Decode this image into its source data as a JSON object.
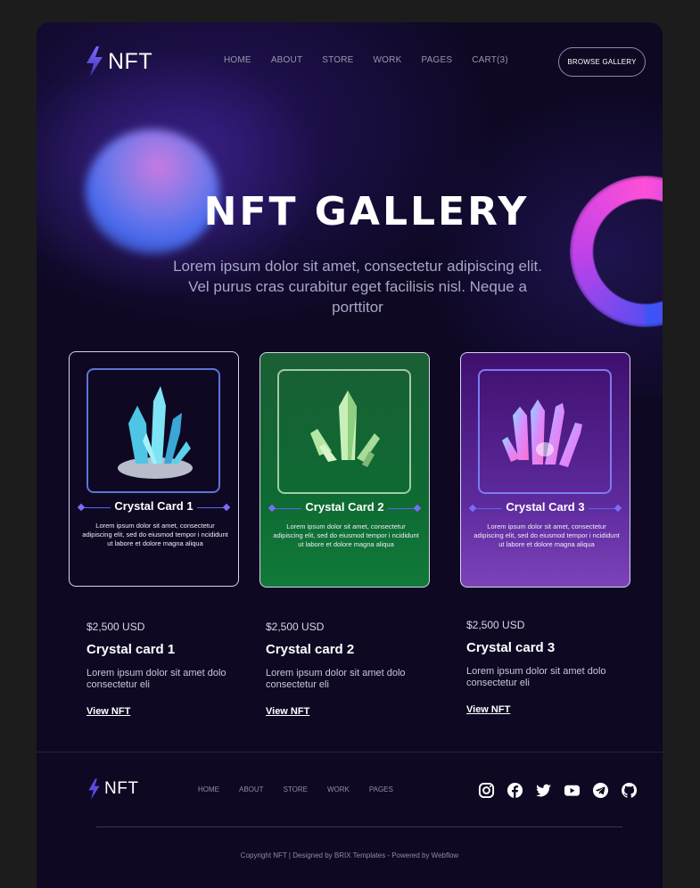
{
  "brand": {
    "name": "NFT"
  },
  "nav": [
    "HOME",
    "ABOUT",
    "STORE",
    "WORK",
    "PAGES",
    "CART(3)"
  ],
  "header": {
    "button_label": "BROWSE GALLERY"
  },
  "hero": {
    "title": "NFT GALLERY",
    "subtitle": "Lorem ipsum dolor sit amet, consectetur adipiscing elit. Vel purus cras curabitur eget facilisis nisl. Neque a porttitor"
  },
  "cards": [
    {
      "title": "Crystal Card 1",
      "desc": "Lorem ipsum dolor sit amet, consectetur adipiscing elit, sed do eiusmod tempor i ncididunt ut labore et dolore magna aliqua",
      "price": "$2,500 USD",
      "name": "Crystal card 1",
      "info": "Lorem ipsum dolor sit amet dolo consectetur eli",
      "link": "View NFT"
    },
    {
      "title": "Crystal Card 2",
      "desc": "Lorem ipsum dolor sit amet, consectetur adipiscing elit, sed do eiusmod tempor i ncididunt ut labore et dolore magna aliqua",
      "price": "$2,500 USD",
      "name": "Crystal card 2",
      "info": "Lorem ipsum dolor sit amet dolo consectetur eli",
      "link": "View NFT"
    },
    {
      "title": "Crystal Card 3",
      "desc": "Lorem ipsum dolor sit amet, consectetur adipiscing elit, sed do eiusmod tempor i ncididunt ut labore et dolore magna aliqua",
      "price": "$2,500 USD",
      "name": "Crystal card 3",
      "info": "Lorem ipsum dolor sit amet dolo consectetur eli",
      "link": "View NFT"
    }
  ],
  "footer": {
    "brand": "NFT",
    "nav": [
      "HOME",
      "ABOUT",
      "STORE",
      "WORK",
      "PAGES"
    ],
    "socials": [
      "instagram-icon",
      "facebook-icon",
      "twitter-icon",
      "youtube-icon",
      "telegram-icon",
      "github-icon"
    ],
    "copyright": "Copyright   NFT  |  Designed by BRIX Templates - Powered by Webflow"
  },
  "colors": {
    "page_bg": "#0e0823",
    "accent": "#5b63f3",
    "card2_bg": "#0e6a32",
    "card3_bg": "#5e2b9e"
  }
}
